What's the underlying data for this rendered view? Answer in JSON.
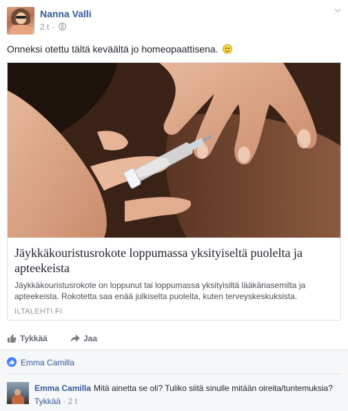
{
  "post": {
    "author": "Nanna Valli",
    "time": "2 t",
    "text": "Onneksi otettu tältä keväältä jo homeopaattisena."
  },
  "link": {
    "title": "Jäykkäkouristusrokote loppumassa yksityiseltä puolelta ja apteekeista",
    "description": "Jäykkäkouristusrokote on loppunut tai loppumassa yksityisiltä lääkäriasemilta ja apteekeista. Rokotetta saa enää julkiselta puolelta, kuten terveyskeskuksista.",
    "domain": "ILTALEHTI.FI"
  },
  "actions": {
    "like_label": "Tykkää",
    "share_label": "Jaa"
  },
  "likes": {
    "names": "Emma Camilla"
  },
  "comment": {
    "author": "Emma Camilla",
    "text": "Mitä ainetta se oli? Tuliko siitä sinulle mitään oireita/tuntemuksia?",
    "like_label": "Tykkää",
    "separator": " · ",
    "time": "2 t"
  },
  "colors": {
    "link_blue": "#365899",
    "like_badge": "#4080ff",
    "meta_gray": "#90949c"
  },
  "icons": [
    "globe-icon",
    "chevron-down-icon",
    "smiley-emoji-icon",
    "thumbs-up-icon",
    "share-arrow-icon"
  ]
}
